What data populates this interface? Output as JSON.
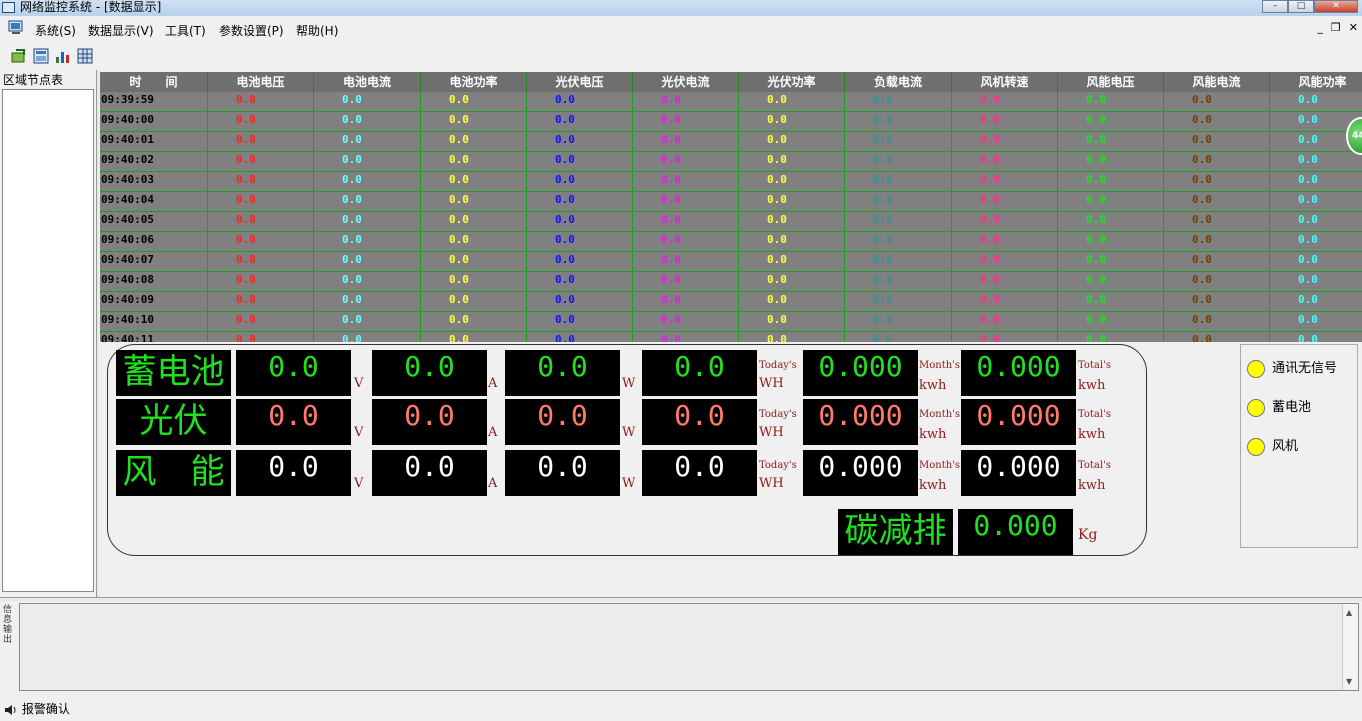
{
  "window": {
    "title": "网络监控系统 - [数据显示]"
  },
  "menu": {
    "items": [
      "系统(S)",
      "数据显示(V)",
      "工具(T)",
      "参数设置(P)",
      "帮助(H)"
    ],
    "mdi_controls": [
      "_",
      "❐",
      "✕"
    ]
  },
  "left_panel": {
    "title": "区域节点表"
  },
  "grid": {
    "headers": [
      "时　　间",
      "电池电压",
      "电池电流",
      "电池功率",
      "光伏电压",
      "光伏电流",
      "光伏功率",
      "负载电流",
      "风机转速",
      "风能电压",
      "风能电流",
      "风能功率"
    ],
    "rows": [
      {
        "time": "09:39:59",
        "values": [
          "0.0",
          "0.0",
          "0.0",
          "0.0",
          "0.0",
          "0.0",
          "0.0",
          "0.0",
          "0.0",
          "0.0",
          "0.0"
        ]
      },
      {
        "time": "09:40:00",
        "values": [
          "0.0",
          "0.0",
          "0.0",
          "0.0",
          "0.0",
          "0.0",
          "0.0",
          "0.0",
          "0.0",
          "0.0",
          "0.0"
        ]
      },
      {
        "time": "09:40:01",
        "values": [
          "0.0",
          "0.0",
          "0.0",
          "0.0",
          "0.0",
          "0.0",
          "0.0",
          "0.0",
          "0.0",
          "0.0",
          "0.0"
        ]
      },
      {
        "time": "09:40:02",
        "values": [
          "0.0",
          "0.0",
          "0.0",
          "0.0",
          "0.0",
          "0.0",
          "0.0",
          "0.0",
          "0.0",
          "0.0",
          "0.0"
        ]
      },
      {
        "time": "09:40:03",
        "values": [
          "0.0",
          "0.0",
          "0.0",
          "0.0",
          "0.0",
          "0.0",
          "0.0",
          "0.0",
          "0.0",
          "0.0",
          "0.0"
        ]
      },
      {
        "time": "09:40:04",
        "values": [
          "0.0",
          "0.0",
          "0.0",
          "0.0",
          "0.0",
          "0.0",
          "0.0",
          "0.0",
          "0.0",
          "0.0",
          "0.0"
        ]
      },
      {
        "time": "09:40:05",
        "values": [
          "0.0",
          "0.0",
          "0.0",
          "0.0",
          "0.0",
          "0.0",
          "0.0",
          "0.0",
          "0.0",
          "0.0",
          "0.0"
        ]
      },
      {
        "time": "09:40:06",
        "values": [
          "0.0",
          "0.0",
          "0.0",
          "0.0",
          "0.0",
          "0.0",
          "0.0",
          "0.0",
          "0.0",
          "0.0",
          "0.0"
        ]
      },
      {
        "time": "09:40:07",
        "values": [
          "0.0",
          "0.0",
          "0.0",
          "0.0",
          "0.0",
          "0.0",
          "0.0",
          "0.0",
          "0.0",
          "0.0",
          "0.0"
        ]
      },
      {
        "time": "09:40:08",
        "values": [
          "0.0",
          "0.0",
          "0.0",
          "0.0",
          "0.0",
          "0.0",
          "0.0",
          "0.0",
          "0.0",
          "0.0",
          "0.0"
        ]
      },
      {
        "time": "09:40:09",
        "values": [
          "0.0",
          "0.0",
          "0.0",
          "0.0",
          "0.0",
          "0.0",
          "0.0",
          "0.0",
          "0.0",
          "0.0",
          "0.0"
        ]
      },
      {
        "time": "09:40:10",
        "values": [
          "0.0",
          "0.0",
          "0.0",
          "0.0",
          "0.0",
          "0.0",
          "0.0",
          "0.0",
          "0.0",
          "0.0",
          "0.0"
        ]
      },
      {
        "time": "09:40:11",
        "values": [
          "0.0",
          "0.0",
          "0.0",
          "0.0",
          "0.0",
          "0.0",
          "0.0",
          "0.0",
          "0.0",
          "0.0",
          "0.0"
        ]
      }
    ],
    "column_colors": [
      "#ff2020",
      "#66ffff",
      "#ffff40",
      "#1010ff",
      "#e020e0",
      "#ffff40",
      "#3a8f8f",
      "#ff2d8a",
      "#20e020",
      "#6b4400",
      "#40ffff"
    ]
  },
  "dashboard": {
    "rows": [
      {
        "label": "蓄电池",
        "label_color": "#20e020",
        "v": "0.0",
        "a": "0.0",
        "w": "0.0",
        "p": "0.0",
        "value_color": "#20e020",
        "today": "0.000",
        "month": "0.000"
      },
      {
        "label": "光伏",
        "label_color": "#20e020",
        "v": "0.0",
        "a": "0.0",
        "w": "0.0",
        "p": "0.0",
        "value_color": "#ff7a6a",
        "today": "0.000",
        "month": "0.000"
      },
      {
        "label": "风　能",
        "label_color": "#20e020",
        "v": "0.0",
        "a": "0.0",
        "w": "0.0",
        "p": "0.0",
        "value_color": "#ffffff",
        "today": "0.000",
        "month": "0.000"
      }
    ],
    "units": {
      "v": "V",
      "a": "A",
      "w": "W",
      "today": "Today's",
      "wh": "WH",
      "month": "Month's",
      "kwh": "kwh",
      "total": "Total's"
    },
    "carbon": {
      "label": "碳减排",
      "value": "0.000",
      "unit": "Kg"
    }
  },
  "status": {
    "items": [
      "通讯无信号",
      "蓄电池",
      "风机"
    ],
    "led_color": "#ffff00"
  },
  "floating_badge": "44",
  "bottom": {
    "side_label": "信息输出",
    "alarm_label": "报警确认"
  }
}
